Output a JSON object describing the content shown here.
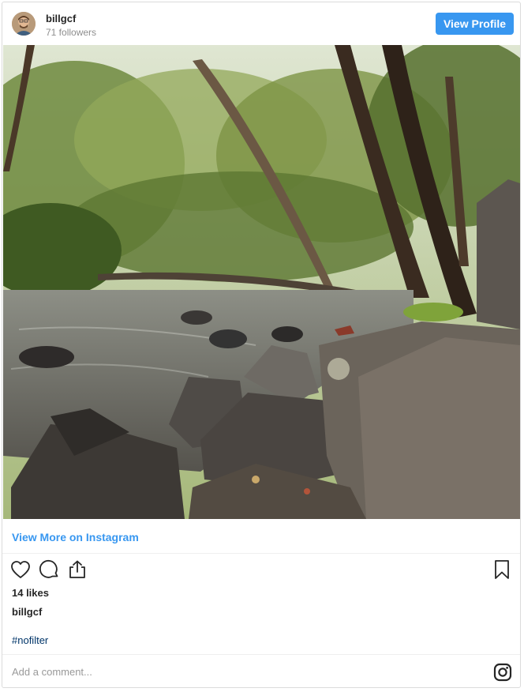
{
  "header": {
    "username": "billgcf",
    "followers": "71 followers",
    "view_profile_label": "View Profile"
  },
  "post": {
    "view_more_label": "View More on Instagram",
    "likes": "14 likes",
    "caption_user": "billgcf",
    "hashtag": "#nofilter"
  },
  "comment": {
    "placeholder": "Add a comment..."
  },
  "icons": {
    "like": "heart-icon",
    "comment": "comment-icon",
    "share": "share-icon",
    "save": "bookmark-icon",
    "instagram": "instagram-icon"
  },
  "colors": {
    "accent": "#3897f0",
    "hashtag": "#003569",
    "muted": "#8e8e8e"
  }
}
